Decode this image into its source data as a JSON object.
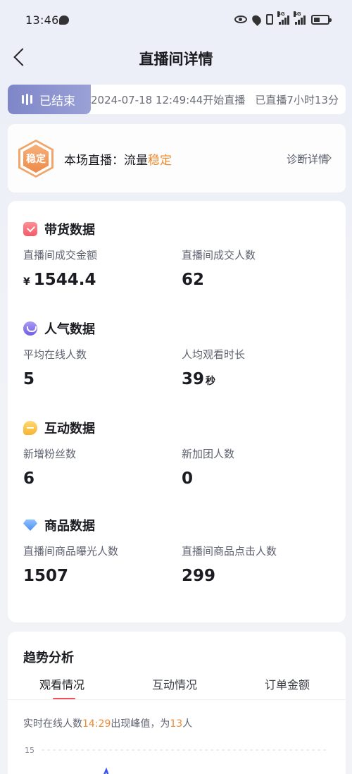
{
  "status_bar": {
    "time": "13:46",
    "network_1": "5G",
    "network_2": "4G"
  },
  "nav": {
    "title": "直播间详情"
  },
  "live_status": {
    "ended_label": "已结束",
    "start_info": "2024-07-18 12:49:44开始直播",
    "duration_info": "已直播7小时13分"
  },
  "stability": {
    "badge": "稳定",
    "prefix": "本场直播：流量",
    "value": "稳定",
    "link": "诊断详情",
    "accent_color": "#ef8b2f"
  },
  "sections": [
    {
      "title": "带货数据",
      "icon": "shopping-bag-icon",
      "metrics": [
        {
          "label": "直播间成交金额",
          "prefix": "¥",
          "value": "1544.4",
          "suffix": ""
        },
        {
          "label": "直播间成交人数",
          "prefix": "",
          "value": "62",
          "suffix": ""
        }
      ]
    },
    {
      "title": "人气数据",
      "icon": "popularity-icon",
      "metrics": [
        {
          "label": "平均在线人数",
          "prefix": "",
          "value": "5",
          "suffix": ""
        },
        {
          "label": "人均观看时长",
          "prefix": "",
          "value": "39",
          "suffix": "秒"
        }
      ]
    },
    {
      "title": "互动数据",
      "icon": "chat-bubble-icon",
      "metrics": [
        {
          "label": "新增粉丝数",
          "prefix": "",
          "value": "6",
          "suffix": ""
        },
        {
          "label": "新加团人数",
          "prefix": "",
          "value": "0",
          "suffix": ""
        }
      ]
    },
    {
      "title": "商品数据",
      "icon": "diamond-icon",
      "metrics": [
        {
          "label": "直播间商品曝光人数",
          "prefix": "",
          "value": "1507",
          "suffix": ""
        },
        {
          "label": "直播间商品点击人数",
          "prefix": "",
          "value": "299",
          "suffix": ""
        }
      ]
    }
  ],
  "trend": {
    "title": "趋势分析",
    "tabs": [
      "观看情况",
      "互动情况",
      "订单金额"
    ],
    "active_tab": 0,
    "peak_prefix": "实时在线人数",
    "peak_time": "14:29",
    "peak_middle": "出现峰值，为",
    "peak_value": "13",
    "peak_suffix": "人",
    "accent_color": "#f0505a"
  },
  "chart_data": {
    "type": "line",
    "y_tick_labels": [
      "15"
    ],
    "ylim": [
      0,
      15
    ],
    "grid": true
  }
}
